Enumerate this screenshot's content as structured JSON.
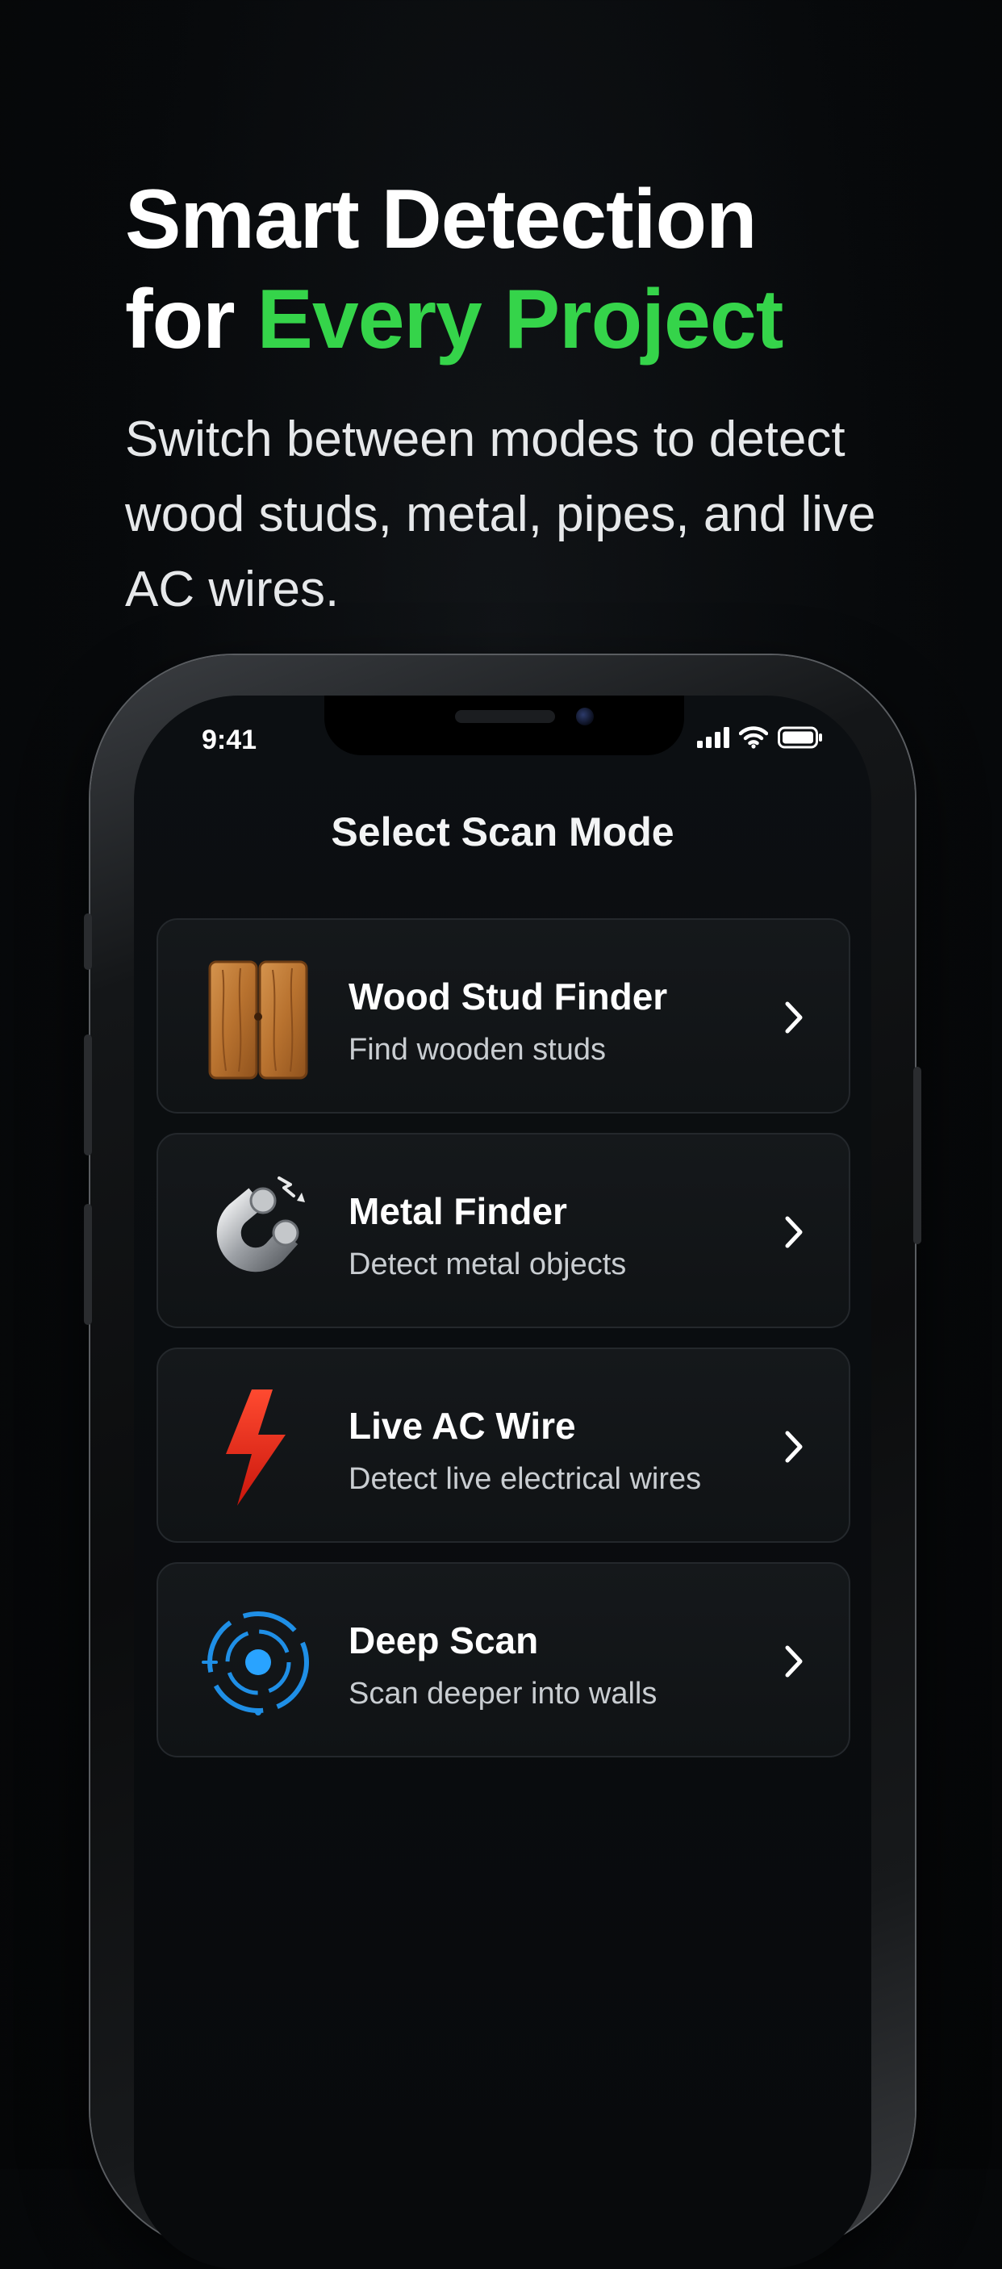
{
  "hero": {
    "title_line1": "Smart Detection",
    "title_line2_prefix": "for ",
    "title_line2_accent": "Every Project",
    "subtitle": "Switch between modes to detect wood studs, metal, pipes, and live AC wires."
  },
  "colors": {
    "accent_green": "#35d44a",
    "background": "#07090b",
    "card_background": "#15181b"
  },
  "status_bar": {
    "time": "9:41",
    "icons": [
      "cellular-signal-icon",
      "wifi-icon",
      "battery-icon"
    ]
  },
  "screen": {
    "title": "Select Scan Mode",
    "modes": [
      {
        "title": "Wood Stud Finder",
        "description": "Find wooden studs",
        "icon": "wood-plank-icon"
      },
      {
        "title": "Metal Finder",
        "description": "Detect metal objects",
        "icon": "magnet-icon"
      },
      {
        "title": "Live AC Wire",
        "description": "Detect live electrical wires",
        "icon": "lightning-bolt-icon"
      },
      {
        "title": "Deep Scan",
        "description": "Scan deeper into walls",
        "icon": "radar-scan-icon"
      }
    ]
  }
}
